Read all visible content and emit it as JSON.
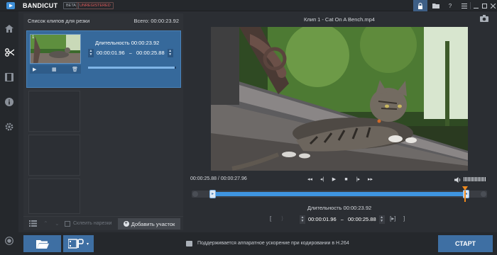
{
  "app": {
    "logo": "BANDICUT",
    "badge_beta": "BETA",
    "badge_unregistered": "UNREGISTERED",
    "titlebar_buttons": [
      "lock-icon",
      "folder-icon",
      "help-icon",
      "menu-icon",
      "minimize-icon",
      "maximize-icon",
      "close-icon"
    ]
  },
  "nav": {
    "items": [
      "home-icon",
      "cut-icon",
      "film-icon",
      "info-icon",
      "settings-icon",
      "record-icon"
    ],
    "active": "cut-icon"
  },
  "clip_panel": {
    "title": "Список клипов для резки",
    "total": "Всего: 00:00:23.92",
    "clips": [
      {
        "number": "1",
        "duration_label": "Длительность 00:00:23.92",
        "start": "00:00:01.96",
        "separator": "~",
        "end": "00:00:25.88",
        "progress": 0.98
      }
    ],
    "merge_label": "Склеить нарезки",
    "add_label": "Добавить участок"
  },
  "player": {
    "clip_title": "Клип 1 - Cat On A Bench.mp4",
    "time_display": "00:00:25.88 / 00:00:27.96",
    "volume": 0.9,
    "selection_start_fraction": 0.07,
    "selection_end_fraction": 0.93,
    "playhead_fraction": 0.925,
    "duration_label": "Длительность 00:00:23.92",
    "start": "00:00:01.96",
    "separator": "~",
    "end": "00:00:25.88"
  },
  "bottom": {
    "hint": "Поддерживается аппаратное ускорение при кодировании в H.264",
    "start_label": "СТАРТ"
  },
  "colors": {
    "accent": "#3e6fa3",
    "selection": "#3f95e0",
    "playhead": "#f08a1c"
  }
}
